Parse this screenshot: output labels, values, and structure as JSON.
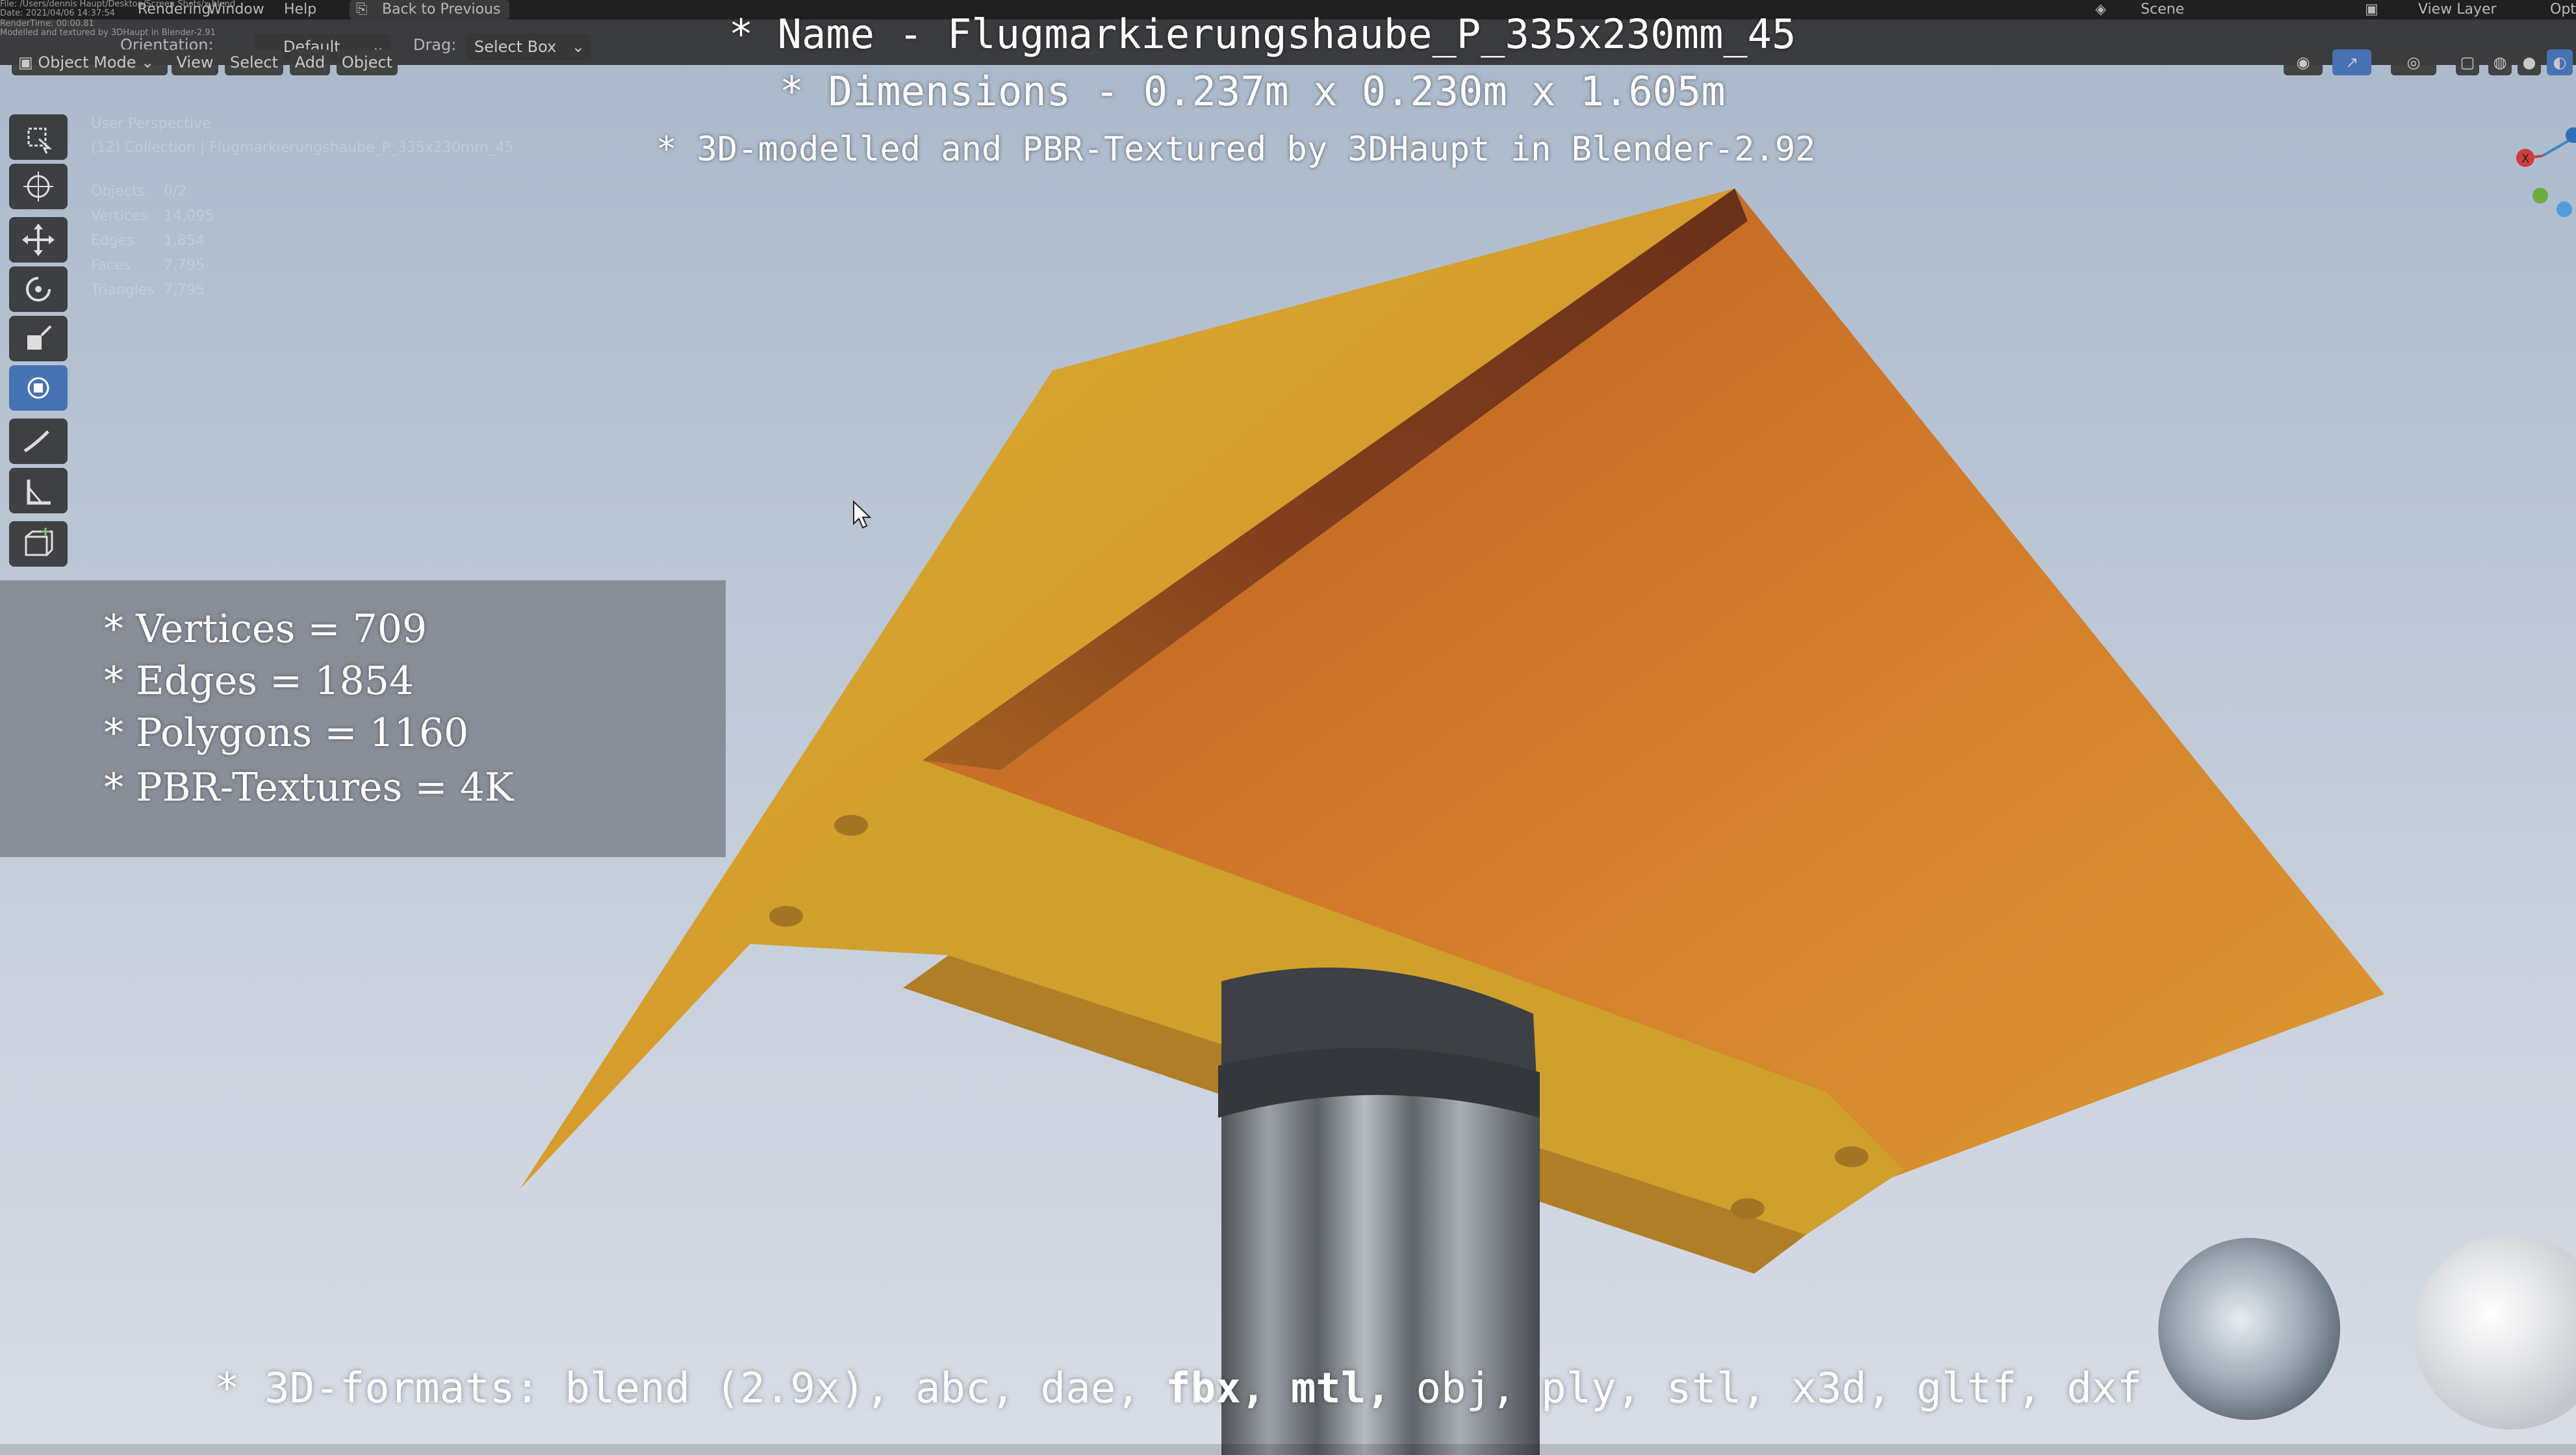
{
  "topbar": {
    "menu": [
      "Rendering",
      "Window",
      "Help"
    ],
    "back_button": "Back to Previous",
    "scene_label": "Scene",
    "view_layer_label": "View Layer",
    "options_label": "Opti"
  },
  "file_info_lines": [
    "File: /Users/dennis Haupt/Desktop/Screen Shots/x.blend",
    "Date: 2021/04/06 14:37:54",
    "RenderTime: 00:00.81",
    "Modelled and textured by 3DHaupt in Blender-2.91"
  ],
  "header": {
    "orientation_label": "Orientation:",
    "orientation_value": "Default",
    "drag_label": "Drag:",
    "drag_value": "Select Box",
    "mode_label": "Object Mode",
    "menus": [
      "View",
      "Select",
      "Add",
      "Object"
    ]
  },
  "viewport_info": {
    "perspective": "User Perspective",
    "collection": "(12) Collection | Flugmarkierungshaube_P_335x230mm_45",
    "objects_label": "Objects",
    "objects_value": "0/2",
    "vertices_label": "Vertices",
    "vertices_value": "14,095",
    "edges_label": "Edges",
    "edges_value": "1,854",
    "faces_label": "Faces",
    "faces_value": "7,795",
    "triangles_label": "Triangles",
    "triangles_value": "7,795"
  },
  "overlay_text": {
    "name_line": "* Name - Flugmarkierungshaube_P_335x230mm_45",
    "dimensions_line": "* Dimensions -  0.237m x 0.230m x 1.605m",
    "credit_line": "* 3D-modelled and PBR-Textured by 3DHaupt in Blender-2.92"
  },
  "stats": [
    "* Vertices = 709",
    "* Edges = 1854",
    "* Polygons = 1160",
    "* PBR-Textures = 4K"
  ],
  "formats": {
    "prefix": "* 3D-formats: blend (2.9x), abc, dae, ",
    "bold1": "fbx, mtl, ",
    "rest": "obj, ply, stl, x3d, gltf, dxf"
  },
  "gizmo_axis_label": "X",
  "colors": {
    "sky_top": "#a7b6c8",
    "sky_bottom": "#d3d9e4",
    "cap_yellow": "#d9a92a",
    "cap_orange": "#d9822b",
    "cap_shadow": "#8a4a1e",
    "pole_metal": "#8d9298",
    "blender_accent": "#4772b3"
  },
  "icons": [
    "select-box-icon",
    "cursor-icon",
    "move-icon",
    "rotate-icon",
    "scale-icon",
    "transform-icon",
    "annotate-icon",
    "measure-icon",
    "add-cube-icon"
  ]
}
